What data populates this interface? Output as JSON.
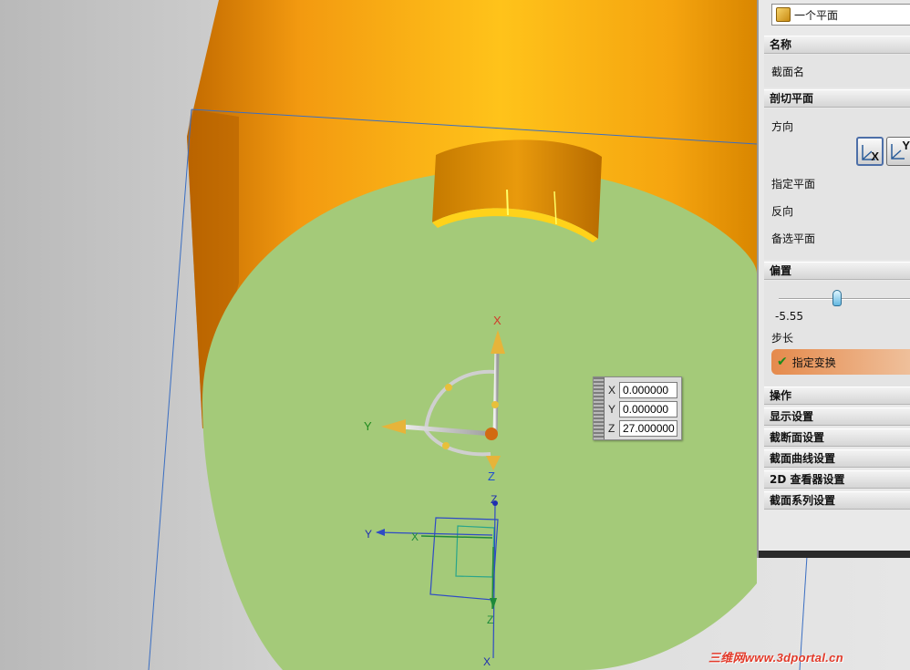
{
  "viewport": {
    "colors": {
      "background": "#d6d6d6",
      "cylinder_body": "#f0a10e",
      "section_face": "#a4ca79",
      "edge_lines": "#3a6ec2",
      "axis_x_label": "#d23a2a",
      "axis_y_label": "#1e8a1e",
      "axis_z_label": "#1f4fd0"
    },
    "triad": {
      "x_label": "X",
      "y_label": "Y",
      "z_label": "Z"
    },
    "wcs": {
      "z_top_label": "Z",
      "y_label": "Y",
      "x_green_label": "X",
      "z_bottom_label": "Z",
      "x_bottom_label": "X"
    },
    "coord_readout": {
      "x_label": "X",
      "x_value": "0.000000",
      "y_label": "Y",
      "y_value": "0.000000",
      "z_label": "Z",
      "z_value": "27.000000"
    }
  },
  "panel": {
    "type_value": "一个平面",
    "sections": {
      "name_header": "名称",
      "section_name_label": "截面名",
      "cut_plane_header": "剖切平面",
      "direction_label": "方向",
      "direction_buttons": [
        "X",
        "Y"
      ],
      "specify_plane_label": "指定平面",
      "reverse_label": "反向",
      "alternate_plane_label": "备选平面",
      "offset_header": "偏置",
      "offset_value": "-5.55",
      "offset_fraction": 0.41,
      "step_label": "步长",
      "specify_transform_label": "指定变换",
      "operation_header": "操作",
      "display_settings": "显示设置",
      "section_face_settings": "截断面设置",
      "section_curve_settings": "截面曲线设置",
      "viewer_2d_settings": "2D 查看器设置",
      "section_family_settings": "截面系列设置"
    }
  },
  "watermark": "三维网www.3dportal.cn"
}
